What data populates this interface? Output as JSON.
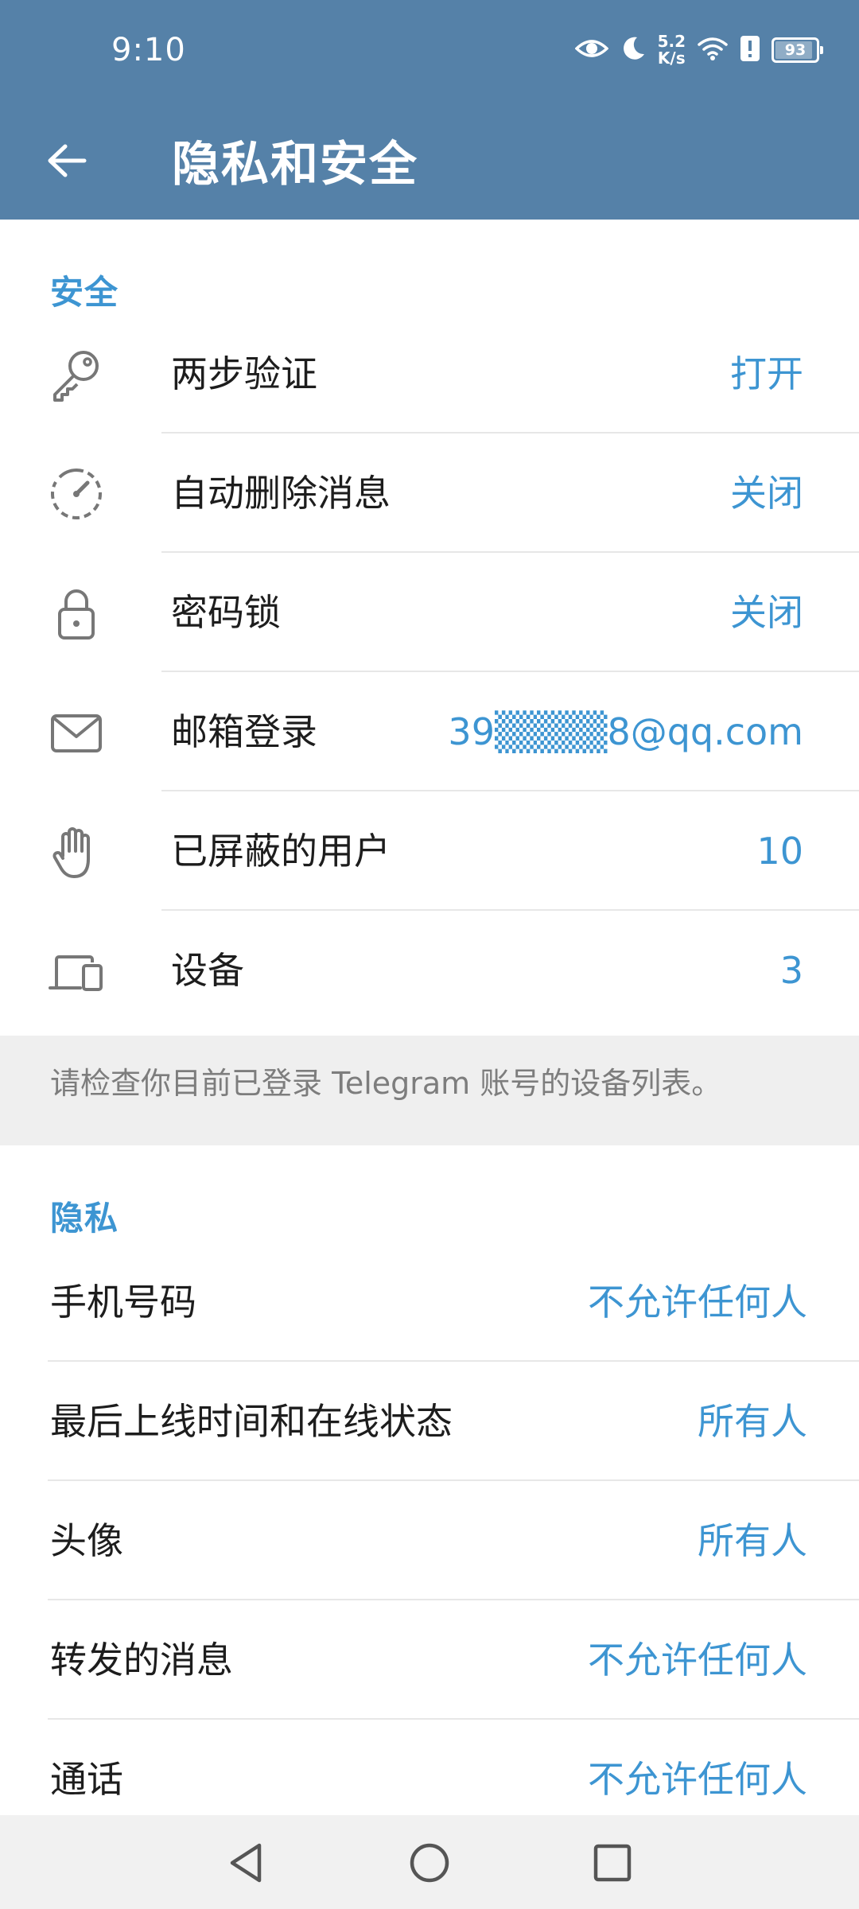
{
  "status_bar": {
    "time": "9:10",
    "net_speed_value": "5.2",
    "net_speed_unit": "K/s",
    "battery_level": "93",
    "battery_percent": 93,
    "icons": [
      "eye-icon",
      "moon-icon",
      "wifi-icon",
      "alert-icon",
      "battery-icon"
    ]
  },
  "app_bar": {
    "title": "隐私和安全",
    "back_icon": "arrow-left-icon"
  },
  "security": {
    "title": "安全",
    "rows": [
      {
        "icon": "key-icon",
        "label": "两步验证",
        "value": "打开"
      },
      {
        "icon": "timer-icon",
        "label": "自动删除消息",
        "value": "关闭"
      },
      {
        "icon": "lock-icon",
        "label": "密码锁",
        "value": "关闭"
      },
      {
        "icon": "mail-icon",
        "label": "邮箱登录",
        "value": "39▒▒▒▒8@qq.com"
      },
      {
        "icon": "hand-icon",
        "label": "已屏蔽的用户",
        "value": "10"
      },
      {
        "icon": "devices-icon",
        "label": "设备",
        "value": "3"
      }
    ],
    "footer": "请检查你目前已登录 Telegram 账号的设备列表。"
  },
  "privacy": {
    "title": "隐私",
    "rows": [
      {
        "label": "手机号码",
        "value": "不允许任何人"
      },
      {
        "label": "最后上线时间和在线状态",
        "value": "所有人"
      },
      {
        "label": "头像",
        "value": "所有人"
      },
      {
        "label": "转发的消息",
        "value": "不允许任何人"
      },
      {
        "label": "通话",
        "value": "不允许任何人"
      }
    ]
  },
  "nav": {
    "icons": [
      "nav-back-icon",
      "nav-home-icon",
      "nav-recents-icon"
    ]
  },
  "colors": {
    "header": "#5581a8",
    "accent": "#3d95d2",
    "footer_bg": "#efefef"
  }
}
